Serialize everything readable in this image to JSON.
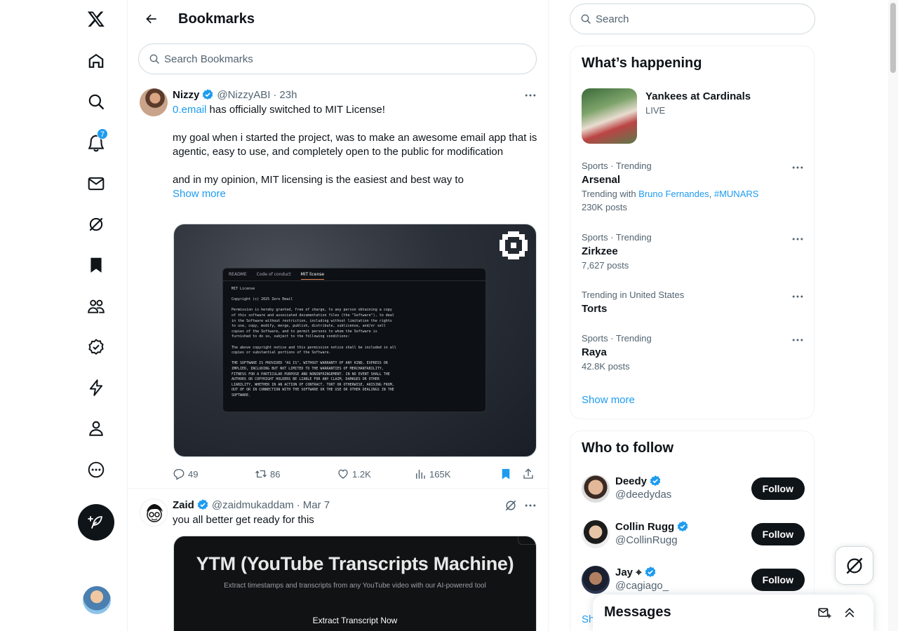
{
  "nav": {
    "logo_icon": "x-logo-icon",
    "items": [
      {
        "name": "home",
        "icon": "home-icon"
      },
      {
        "name": "explore",
        "icon": "search-icon"
      },
      {
        "name": "notifications",
        "icon": "bell-icon",
        "badge": "7"
      },
      {
        "name": "messages",
        "icon": "mail-icon"
      },
      {
        "name": "grok",
        "icon": "grok-icon"
      },
      {
        "name": "bookmarks",
        "icon": "bookmark-icon"
      },
      {
        "name": "communities",
        "icon": "people-icon"
      },
      {
        "name": "premium",
        "icon": "verified-icon"
      },
      {
        "name": "verified-orgs",
        "icon": "lightning-icon"
      },
      {
        "name": "profile",
        "icon": "person-icon"
      },
      {
        "name": "more",
        "icon": "more-circle-icon"
      }
    ],
    "post_button_icon": "feather-plus-icon"
  },
  "header": {
    "title": "Bookmarks",
    "search_placeholder": "Search Bookmarks"
  },
  "tweets": [
    {
      "name": "Nizzy",
      "handle": "@NizzyABI",
      "sep": "·",
      "time": "23h",
      "body_link": "0.email",
      "body_line1_rest": " has officially switched to MIT License!",
      "body_p2": "my goal when i started the project, was to make an awesome email app that is agentic, easy to use, and completely open to the public for modification",
      "body_p3": "and in my opinion, MIT licensing is the easiest and best way to",
      "show_more": "Show more",
      "media": {
        "tabs": [
          "README",
          "Code of conduct",
          "MIT license"
        ],
        "text": "MIT License\n\nCopyright (c) 2025 Zero Email\n\nPermission is hereby granted, free of charge, to any person obtaining a copy\nof this software and associated documentation files (the \"Software\"), to deal\nin the Software without restriction, including without limitation the rights\nto use, copy, modify, merge, publish, distribute, sublicense, and/or sell\ncopies of the Software, and to permit persons to whom the Software is\nfurnished to do so, subject to the following conditions:\n\nThe above copyright notice and this permission notice shall be included in all\ncopies or substantial portions of the Software.\n\nTHE SOFTWARE IS PROVIDED \"AS IS\", WITHOUT WARRANTY OF ANY KIND, EXPRESS OR\nIMPLIED, INCLUDING BUT NOT LIMITED TO THE WARRANTIES OF MERCHANTABILITY,\nFITNESS FOR A PARTICULAR PURPOSE AND NONINFRINGEMENT. IN NO EVENT SHALL THE\nAUTHORS OR COPYRIGHT HOLDERS BE LIABLE FOR ANY CLAIM, DAMAGES OR OTHER\nLIABILITY, WHETHER IN AN ACTION OF CONTRACT, TORT OR OTHERWISE, ARISING FROM,\nOUT OF OR IN CONNECTION WITH THE SOFTWARE OR THE USE OR OTHER DEALINGS IN THE\nSOFTWARE."
      },
      "replies": "49",
      "reposts": "86",
      "likes": "1.2K",
      "views": "165K"
    },
    {
      "name": "Zaid",
      "handle": "@zaidmukaddam",
      "sep": "·",
      "time": "Mar 7",
      "body": "you all better get ready for this",
      "media": {
        "title": "YTM (YouTube Transcripts Machine)",
        "subtitle": "Extract timestamps and transcripts from any YouTube video with our AI-powered tool",
        "button": "Extract Transcript Now"
      }
    }
  ],
  "search": {
    "placeholder": "Search"
  },
  "happening": {
    "title": "What’s happening",
    "featured": {
      "title": "Yankees at Cardinals",
      "status": "LIVE"
    },
    "trends": [
      {
        "meta": "Sports · Trending",
        "name": "Arsenal",
        "with_label": "Trending with ",
        "with_1": "Bruno Fernandes",
        "with_comma": ", ",
        "with_2": "#MUNARS",
        "count": "230K posts"
      },
      {
        "meta": "Sports · Trending",
        "name": "Zirkzee",
        "count": "7,627 posts"
      },
      {
        "meta": "Trending in United States",
        "name": "Torts"
      },
      {
        "meta": "Sports · Trending",
        "name": "Raya",
        "count": "42.8K posts"
      }
    ],
    "show_more": "Show more"
  },
  "who_to_follow": {
    "title": "Who to follow",
    "users": [
      {
        "name": "Deedy",
        "handle": "@deedydas",
        "button": "Follow"
      },
      {
        "name": "Collin Rugg",
        "handle": "@CollinRugg",
        "button": "Follow"
      },
      {
        "name": "Jay ⌖",
        "handle": "@cagiago_",
        "button": "Follow"
      }
    ],
    "show_more_partial": "Sh"
  },
  "messages_drawer": {
    "title": "Messages"
  },
  "colors": {
    "accent": "#1d9bf0",
    "text": "#0f1419",
    "muted": "#536471",
    "border": "#eff3f4"
  }
}
